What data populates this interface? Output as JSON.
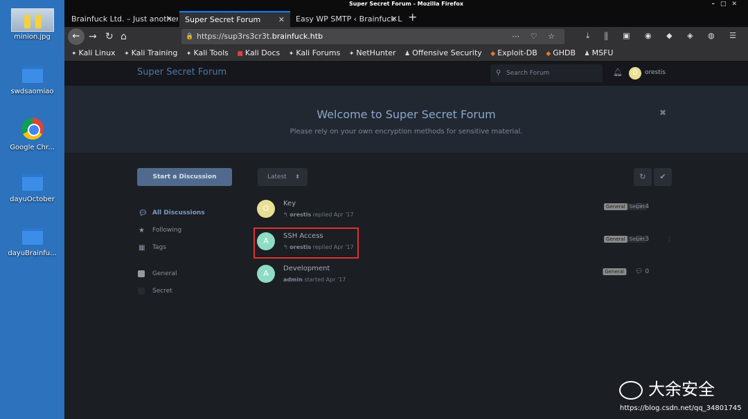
{
  "desktop": {
    "icons": [
      {
        "label": "minion.jpg"
      },
      {
        "label": "swdsaomiao"
      },
      {
        "label": "Google Chr..."
      },
      {
        "label": "dayuOctober"
      },
      {
        "label": "dayuBrainfu..."
      }
    ]
  },
  "browser": {
    "window_title": "Super Secret Forum - Mozilla Firefox",
    "tabs": [
      {
        "label": "Brainfuck Ltd. – Just another"
      },
      {
        "label": "Super Secret Forum"
      },
      {
        "label": "Easy WP SMTP ‹ Brainfuck L"
      }
    ],
    "url_prefix": "https://sup3rs3cr3t.",
    "url_host": "brainfuck.htb",
    "bookmarks": [
      "Kali Linux",
      "Kali Training",
      "Kali Tools",
      "Kali Docs",
      "Kali Forums",
      "NetHunter",
      "Offensive Security",
      "Exploit-DB",
      "GHDB",
      "MSFU"
    ]
  },
  "forum": {
    "title": "Super Secret Forum",
    "search_placeholder": "Search Forum",
    "user_initial": "O",
    "username": "orestis",
    "hero_title": "Welcome to Super Secret Forum",
    "hero_subtitle": "Please rely on your own encryption methods for sensitive material.",
    "start_button": "Start a Discussion",
    "nav": {
      "all": "All Discussions",
      "following": "Following",
      "tags": "Tags",
      "general": "General",
      "secret": "Secret"
    },
    "sort_label": "Latest",
    "discussions": [
      {
        "initial": "O",
        "avatar_color": "#e8df94",
        "title": "Key",
        "user": "orestis",
        "action": "replied Apr '17",
        "tags": [
          "General",
          "Secret"
        ],
        "count": "4",
        "highlighted": false
      },
      {
        "initial": "A",
        "avatar_color": "#8fdcc4",
        "title": "SSH Access",
        "user": "orestis",
        "action": "replied Apr '17",
        "tags": [
          "General",
          "Secret"
        ],
        "count": "3",
        "highlighted": true
      },
      {
        "initial": "A",
        "avatar_color": "#8fdcc4",
        "title": "Development",
        "user": "admin",
        "action": "started Apr '17",
        "tags": [
          "General"
        ],
        "count": "0",
        "highlighted": false
      }
    ]
  },
  "watermark": {
    "brand": "大余安全",
    "url": "https://blog.csdn.net/qq_34801745"
  }
}
